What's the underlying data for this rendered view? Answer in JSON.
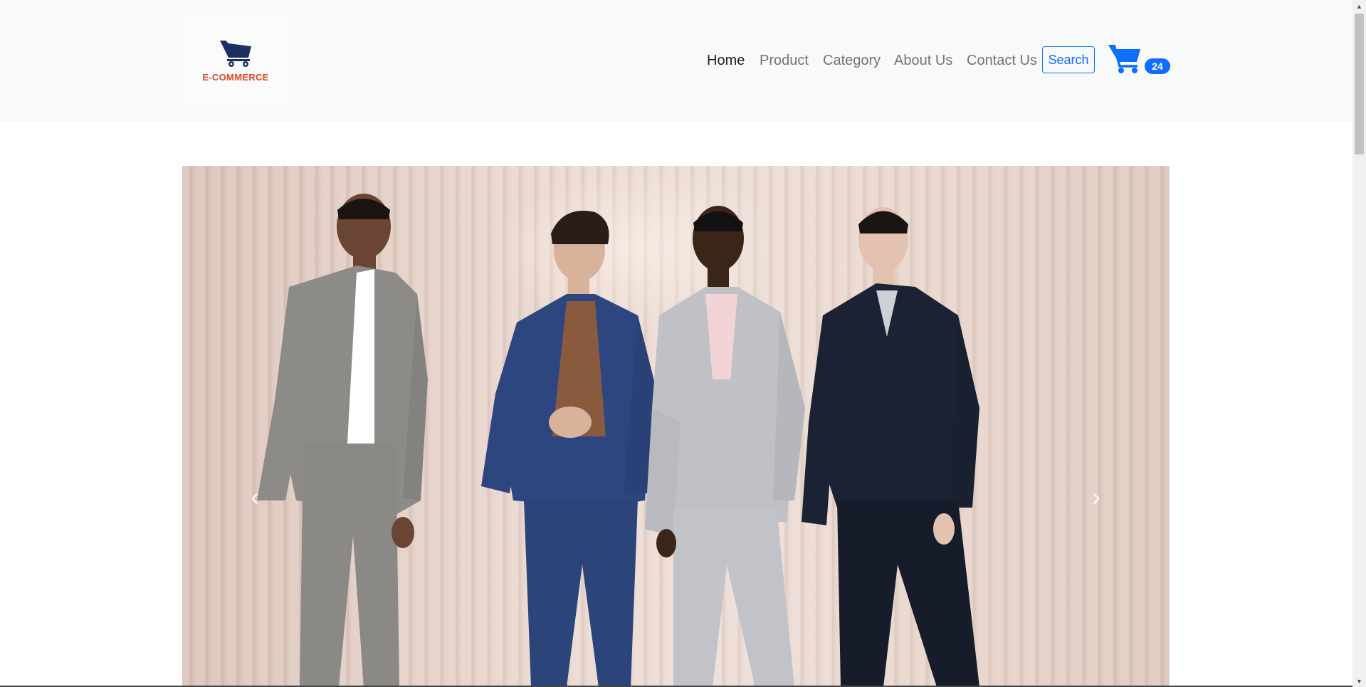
{
  "brand": {
    "name": "E-COMMERCE",
    "icon": "shopping-cart-icon",
    "color": "#e0441f",
    "icon_color": "#1c2f5e"
  },
  "nav": {
    "items": [
      {
        "label": "Home",
        "active": true
      },
      {
        "label": "Product",
        "active": false
      },
      {
        "label": "Category",
        "active": false
      },
      {
        "label": "About Us",
        "active": false
      },
      {
        "label": "Contact Us",
        "active": false
      }
    ],
    "search_label": "Search"
  },
  "cart": {
    "icon": "cart-icon",
    "count": "24"
  },
  "carousel": {
    "prev_icon": "chevron-left-icon",
    "next_icon": "chevron-right-icon",
    "prev_glyph": "‹",
    "next_glyph": "›",
    "image": "four men in suits posing against a pink striped backdrop"
  },
  "colors": {
    "primary": "#0d6efd",
    "navbar_bg": "#f8f9fa",
    "nav_text": "#737373",
    "nav_active": "#222222"
  }
}
